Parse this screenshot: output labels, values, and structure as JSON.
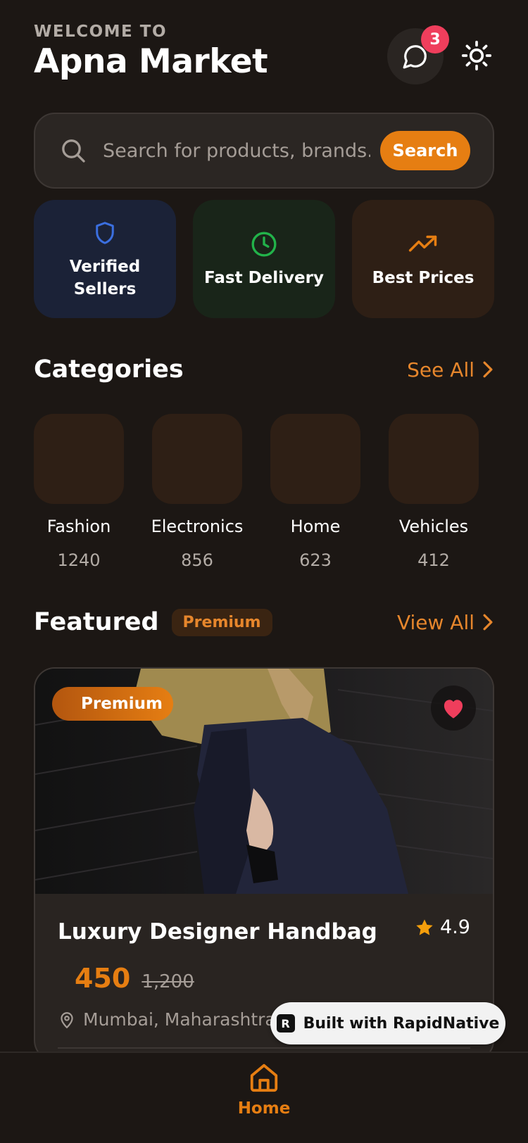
{
  "header": {
    "welcome": "WELCOME TO",
    "title": "Apna Market",
    "notification_count": "3"
  },
  "search": {
    "placeholder": "Search for products, brands...",
    "button": "Search"
  },
  "features": [
    {
      "label": "Verified Sellers",
      "icon": "shield-icon",
      "color": "#3b6fe0"
    },
    {
      "label": "Fast Delivery",
      "icon": "clock-icon",
      "color": "#22b34a"
    },
    {
      "label": "Best Prices",
      "icon": "trending-up-icon",
      "color": "#e67e12"
    }
  ],
  "categories": {
    "title": "Categories",
    "see_all": "See All",
    "items": [
      {
        "name": "Fashion",
        "count": "1240"
      },
      {
        "name": "Electronics",
        "count": "856"
      },
      {
        "name": "Home",
        "count": "623"
      },
      {
        "name": "Vehicles",
        "count": "412"
      }
    ]
  },
  "featured": {
    "title": "Featured",
    "pill": "Premium",
    "view_all": "View All",
    "card": {
      "tag": "Premium",
      "name": "Luxury Designer Handbag",
      "rating": "4.9",
      "price": "450",
      "old_price": "1,200",
      "location": "Mumbai, Maharashtra"
    }
  },
  "watermark": "Built with RapidNative",
  "tabbar": {
    "home": "Home"
  },
  "colors": {
    "accent": "#e67e12",
    "background": "#1c1714",
    "badge": "#ef3e5c",
    "heart": "#ef3e5c"
  }
}
